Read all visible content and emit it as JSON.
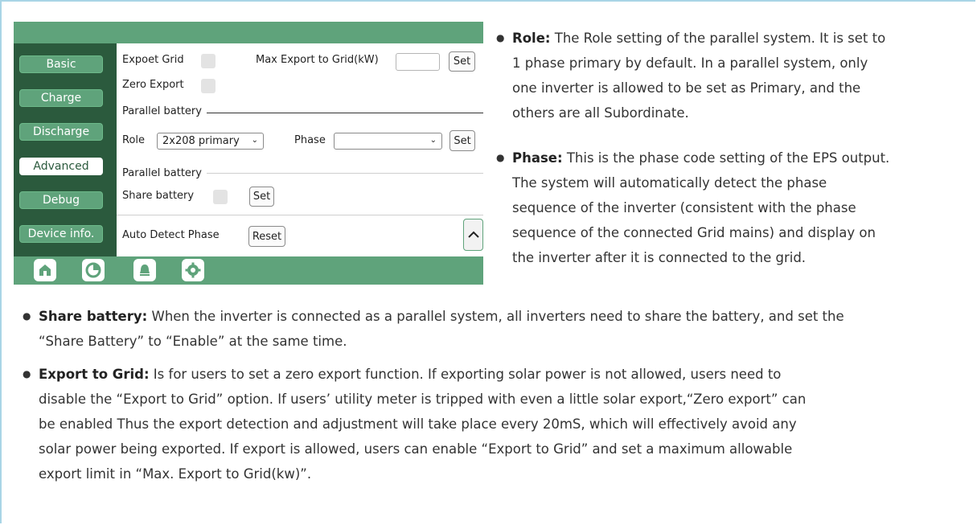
{
  "screen": {
    "side_buttons": [
      "Basic",
      "Charge",
      "Discharge",
      "Advanced",
      "Debug",
      "Device info."
    ],
    "active_button": "Advanced",
    "export_grid_label": "Expoet Grid",
    "max_export_label": "Max Export to Grid(kW)",
    "set_label": "Set",
    "zero_export_label": "Zero Export",
    "parallel_battery_label": "Parallel battery",
    "role_label": "Role",
    "role_value": "2x208 primary",
    "phase_label": "Phase",
    "phase_value": "",
    "share_battery_label": "Share battery",
    "auto_detect_label": "Auto Detect Phase",
    "reset_label": "Reset",
    "nav_icons": [
      "home-icon",
      "pie-chart-icon",
      "bell-icon",
      "gear-icon"
    ],
    "colors": {
      "header_green": "#5fa37b",
      "sidebar_green": "#2b5a3d"
    }
  },
  "role": {
    "term": "Role:",
    "lines": [
      "The Role setting of the parallel system. It is set to",
      "1 phase primary by default. In a parallel system, only",
      "one inverter is allowed to be set as Primary, and the",
      "others are all Subordinate."
    ]
  },
  "phase": {
    "term": "Phase:",
    "lines": [
      "This is the phase code setting of the EPS output.",
      "The system will automatically detect the phase",
      "sequence of the inverter (consistent with the phase",
      "sequence of the connected Grid mains) and display on",
      "the inverter after it is connected to the grid."
    ]
  },
  "share": {
    "term": "Share battery:",
    "lines": [
      "When the inverter is connected as a parallel system, all inverters need to share the battery, and set the",
      "“Share Battery” to “Enable” at the same time."
    ]
  },
  "export": {
    "term": "Export to Grid:",
    "lines": [
      "Is for users to set a zero export function. If exporting solar power is not allowed, users need to",
      "disable the “Export to Grid” option. If users’ utility meter is tripped with even a little solar export,“Zero export” can",
      "be enabled Thus the export detection and adjustment will take place every 20mS, which will effectively avoid any",
      "solar power being exported. If export is allowed, users can enable “Export to Grid” and set a maximum allowable",
      "export limit in “Max. Export to Grid(kw)”."
    ]
  }
}
